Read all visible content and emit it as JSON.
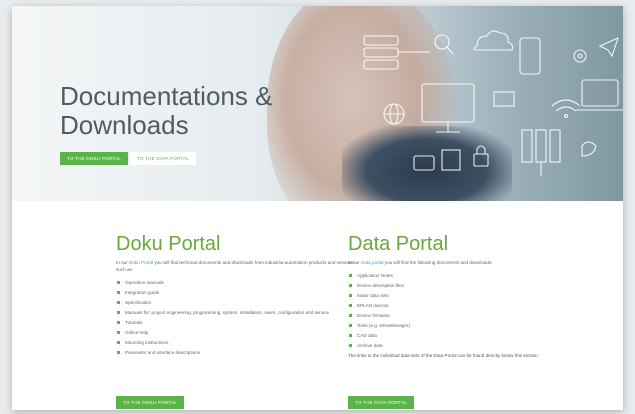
{
  "hero": {
    "title_line1": "Documentations &",
    "title_line2": "Downloads",
    "btn_doku": "TO THE DOKU PORTAL",
    "btn_data": "TO THE DATA PORTAL"
  },
  "doku": {
    "title": "Doku Portal",
    "intro_pre": "In our",
    "intro_link": "Doku Portal",
    "intro_post": "you will find technical documents and downloads from industrial automation products and services such as:",
    "items": [
      "Operation manuals",
      "Integration guide",
      "Specification",
      "Manuals for: project engineering, programming, system, installation, users, configuration and service",
      "Tutorials",
      "Online help",
      "Mounting instructions",
      "Parameter and interface descriptions"
    ],
    "button": "TO THE DOKU PORTAL"
  },
  "data": {
    "title": "Data Portal",
    "intro_pre": "In our",
    "intro_link": "Data portal",
    "intro_post": "you will find the following documents and downloads:",
    "items": [
      "Application Notes",
      "Device description files",
      "Motor data sets",
      "EPLAN macros",
      "Device firmware",
      "Tools (e.g. DriveManager)",
      "CAD data",
      "Archive data"
    ],
    "note": "The links to the individual data sets of the Data Portal can be found directly below this section.",
    "button": "TO THE DATA PORTAL"
  },
  "colors": {
    "accent": "#5bb44a",
    "heading": "#6aa83c",
    "link": "#4aa0d0"
  }
}
